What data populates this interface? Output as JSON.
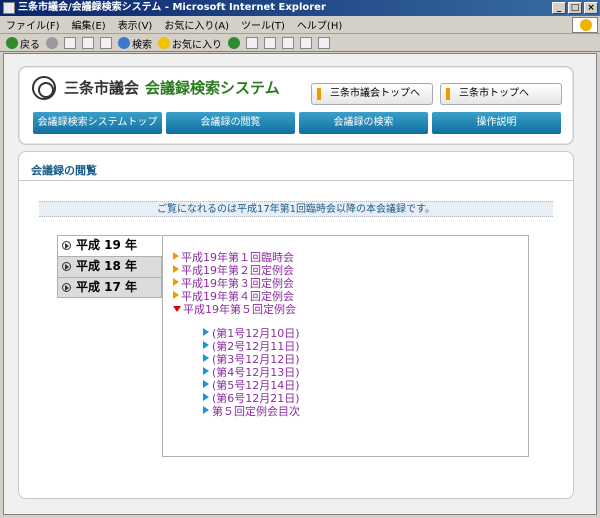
{
  "window": {
    "title": "三条市議会/会議録検索システム - Microsoft Internet Explorer",
    "controls": [
      "_",
      "□",
      "×"
    ]
  },
  "menu": [
    "ファイル(F)",
    "編集(E)",
    "表示(V)",
    "お気に入り(A)",
    "ツール(T)",
    "ヘルプ(H)"
  ],
  "toolbar": {
    "back_label": "戻る",
    "search_label": "検索",
    "favorites_label": "お気に入り"
  },
  "header": {
    "site_name": "三条市議会",
    "system_name": "会議録検索システム",
    "links": [
      "三条市議会トップへ",
      "三条市トップへ"
    ],
    "nav": [
      "会議録検索システムトップ",
      "会議録の閲覧",
      "会議録の検索",
      "操作説明"
    ]
  },
  "main": {
    "section_title": "会議録の閲覧",
    "notice": "ご覧になれるのは平成17年第1回臨時会以降の本会議録です。",
    "year_tabs": [
      "平成 19 年",
      "平成 18 年",
      "平成 17 年"
    ],
    "sessions": [
      "平成19年第１回臨時会",
      "平成19年第２回定例会",
      "平成19年第３回定例会",
      "平成19年第４回定例会",
      "平成19年第５回定例会"
    ],
    "issues": [
      "(第1号12月10日)",
      "(第2号12月11日)",
      "(第3号12月12日)",
      "(第4号12月13日)",
      "(第5号12月14日)",
      "(第6号12月21日)",
      "第５回定例会目次"
    ]
  }
}
